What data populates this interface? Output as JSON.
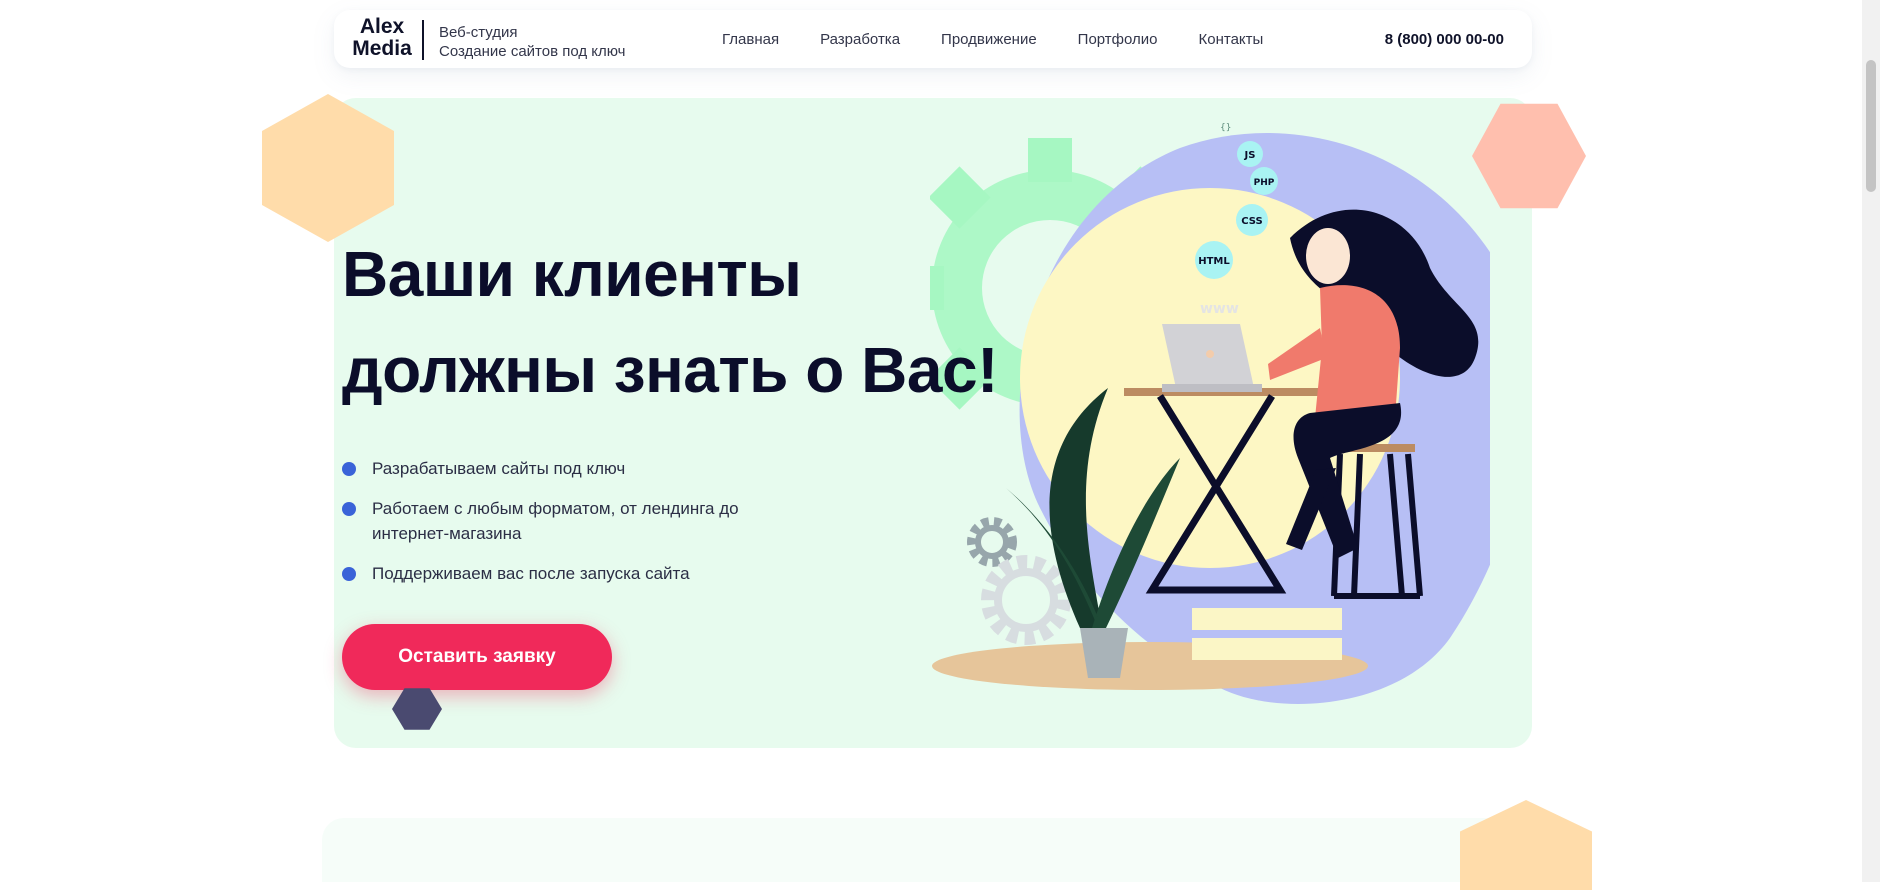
{
  "header": {
    "logo_line1": "Alex",
    "logo_line2": "Media",
    "tagline_line1": "Веб-студия",
    "tagline_line2": "Создание сайтов под ключ",
    "nav": [
      "Главная",
      "Разработка",
      "Продвижение",
      "Портфолио",
      "Контакты"
    ],
    "phone": "8 (800) 000 00-00"
  },
  "hero": {
    "title_line1": "Ваши клиенты",
    "title_line2": "должны знать о Вас!",
    "features": [
      "Разрабатываем сайты под ключ",
      "Работаем с любым форматом, от лендинга до интернет-магазина",
      "Поддерживаем вас после запуска сайта"
    ],
    "cta_label": "Оставить заявку"
  },
  "illustration": {
    "bubbles": [
      "JS",
      "PHP",
      "CSS",
      "HTML"
    ],
    "www_label": "www",
    "brace_label": "{}"
  },
  "colors": {
    "accent": "#f0295a",
    "bullet": "#3a63d8",
    "hero_bg": "#e7fbee",
    "blob": "#b7bff5",
    "sun": "#fdf7c4",
    "gear": "#a6f7c2",
    "bubble": "#a9f3f3"
  },
  "icons": [
    "gear-icon",
    "hexagon-decor",
    "laptop-icon"
  ]
}
